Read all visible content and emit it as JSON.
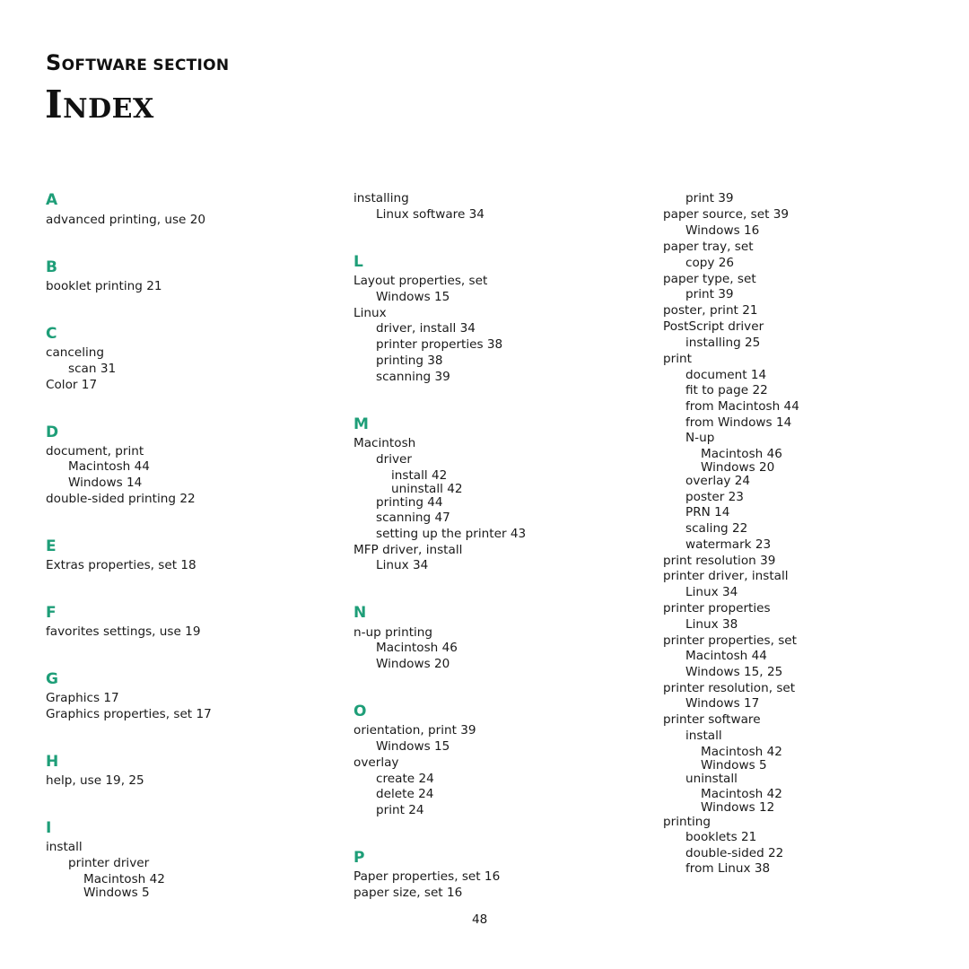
{
  "header": {
    "section_first": "S",
    "section_rest": "OFTWARE SECTION",
    "title_first": "I",
    "title_rest": "NDEX"
  },
  "accent_color": "#1e9e78",
  "page_number": "48",
  "columns": [
    {
      "items": [
        {
          "type": "letter",
          "text": "A"
        },
        {
          "type": "entry",
          "level": 0,
          "text": "advanced printing, use 20"
        },
        {
          "type": "letter",
          "text": "B"
        },
        {
          "type": "entry",
          "level": 0,
          "text": "booklet printing 21"
        },
        {
          "type": "letter",
          "text": "C"
        },
        {
          "type": "entry",
          "level": 0,
          "text": "canceling"
        },
        {
          "type": "entry",
          "level": 1,
          "text": "scan 31"
        },
        {
          "type": "entry",
          "level": 0,
          "text": "Color 17"
        },
        {
          "type": "letter",
          "text": "D"
        },
        {
          "type": "entry",
          "level": 0,
          "text": "document, print"
        },
        {
          "type": "entry",
          "level": 1,
          "text": "Macintosh 44"
        },
        {
          "type": "entry",
          "level": 1,
          "text": "Windows 14"
        },
        {
          "type": "entry",
          "level": 0,
          "text": "double-sided printing 22"
        },
        {
          "type": "letter",
          "text": "E"
        },
        {
          "type": "entry",
          "level": 0,
          "text": "Extras properties, set 18"
        },
        {
          "type": "letter",
          "text": "F"
        },
        {
          "type": "entry",
          "level": 0,
          "text": "favorites settings, use 19"
        },
        {
          "type": "letter",
          "text": "G"
        },
        {
          "type": "entry",
          "level": 0,
          "text": "Graphics 17"
        },
        {
          "type": "entry",
          "level": 0,
          "text": "Graphics properties, set 17"
        },
        {
          "type": "letter",
          "text": "H"
        },
        {
          "type": "entry",
          "level": 0,
          "text": "help, use 19, 25"
        },
        {
          "type": "letter",
          "text": "I"
        },
        {
          "type": "entry",
          "level": 0,
          "text": "install"
        },
        {
          "type": "entry",
          "level": 1,
          "text": "printer driver"
        },
        {
          "type": "entry",
          "level": 2,
          "text": "Macintosh 42"
        },
        {
          "type": "entry",
          "level": 2,
          "text": "Windows 5"
        }
      ]
    },
    {
      "items": [
        {
          "type": "entry",
          "level": 0,
          "text": "installing"
        },
        {
          "type": "entry",
          "level": 1,
          "text": "Linux software 34"
        },
        {
          "type": "letter",
          "text": "L"
        },
        {
          "type": "entry",
          "level": 0,
          "text": "Layout properties, set"
        },
        {
          "type": "entry",
          "level": 1,
          "text": "Windows 15"
        },
        {
          "type": "entry",
          "level": 0,
          "text": "Linux"
        },
        {
          "type": "entry",
          "level": 1,
          "text": "driver, install 34"
        },
        {
          "type": "entry",
          "level": 1,
          "text": "printer properties 38"
        },
        {
          "type": "entry",
          "level": 1,
          "text": "printing 38"
        },
        {
          "type": "entry",
          "level": 1,
          "text": "scanning 39"
        },
        {
          "type": "letter",
          "text": "M"
        },
        {
          "type": "entry",
          "level": 0,
          "text": "Macintosh"
        },
        {
          "type": "entry",
          "level": 1,
          "text": "driver"
        },
        {
          "type": "entry",
          "level": 2,
          "text": "install 42"
        },
        {
          "type": "entry",
          "level": 2,
          "text": "uninstall 42"
        },
        {
          "type": "entry",
          "level": 1,
          "text": "printing 44"
        },
        {
          "type": "entry",
          "level": 1,
          "text": "scanning 47"
        },
        {
          "type": "entry",
          "level": 1,
          "text": "setting up the printer 43"
        },
        {
          "type": "entry",
          "level": 0,
          "text": "MFP driver, install"
        },
        {
          "type": "entry",
          "level": 1,
          "text": "Linux 34"
        },
        {
          "type": "letter",
          "text": "N"
        },
        {
          "type": "entry",
          "level": 0,
          "text": "n-up printing"
        },
        {
          "type": "entry",
          "level": 1,
          "text": "Macintosh 46"
        },
        {
          "type": "entry",
          "level": 1,
          "text": "Windows 20"
        },
        {
          "type": "letter",
          "text": "O"
        },
        {
          "type": "entry",
          "level": 0,
          "text": "orientation, print 39"
        },
        {
          "type": "entry",
          "level": 1,
          "text": "Windows 15"
        },
        {
          "type": "entry",
          "level": 0,
          "text": "overlay"
        },
        {
          "type": "entry",
          "level": 1,
          "text": "create 24"
        },
        {
          "type": "entry",
          "level": 1,
          "text": "delete 24"
        },
        {
          "type": "entry",
          "level": 1,
          "text": "print 24"
        },
        {
          "type": "letter",
          "text": "P"
        },
        {
          "type": "entry",
          "level": 0,
          "text": "Paper properties, set 16"
        },
        {
          "type": "entry",
          "level": 0,
          "text": "paper size, set 16"
        }
      ]
    },
    {
      "items": [
        {
          "type": "entry",
          "level": 1,
          "text": "print 39"
        },
        {
          "type": "entry",
          "level": 0,
          "text": "paper source, set 39"
        },
        {
          "type": "entry",
          "level": 1,
          "text": "Windows 16"
        },
        {
          "type": "entry",
          "level": 0,
          "text": "paper tray, set"
        },
        {
          "type": "entry",
          "level": 1,
          "text": "copy 26"
        },
        {
          "type": "entry",
          "level": 0,
          "text": "paper type, set"
        },
        {
          "type": "entry",
          "level": 1,
          "text": "print 39"
        },
        {
          "type": "entry",
          "level": 0,
          "text": "poster, print 21"
        },
        {
          "type": "entry",
          "level": 0,
          "text": "PostScript driver"
        },
        {
          "type": "entry",
          "level": 1,
          "text": "installing 25"
        },
        {
          "type": "entry",
          "level": 0,
          "text": "print"
        },
        {
          "type": "entry",
          "level": 1,
          "text": "document 14"
        },
        {
          "type": "entry",
          "level": 1,
          "text": "fit to page 22"
        },
        {
          "type": "entry",
          "level": 1,
          "text": "from Macintosh 44"
        },
        {
          "type": "entry",
          "level": 1,
          "text": "from Windows 14"
        },
        {
          "type": "entry",
          "level": 1,
          "text": "N-up"
        },
        {
          "type": "entry",
          "level": 2,
          "text": "Macintosh 46"
        },
        {
          "type": "entry",
          "level": 2,
          "text": "Windows 20"
        },
        {
          "type": "entry",
          "level": 1,
          "text": "overlay 24"
        },
        {
          "type": "entry",
          "level": 1,
          "text": "poster 23"
        },
        {
          "type": "entry",
          "level": 1,
          "text": "PRN 14"
        },
        {
          "type": "entry",
          "level": 1,
          "text": "scaling 22"
        },
        {
          "type": "entry",
          "level": 1,
          "text": "watermark 23"
        },
        {
          "type": "entry",
          "level": 0,
          "text": "print resolution 39"
        },
        {
          "type": "entry",
          "level": 0,
          "text": "printer driver, install"
        },
        {
          "type": "entry",
          "level": 1,
          "text": "Linux 34"
        },
        {
          "type": "entry",
          "level": 0,
          "text": "printer properties"
        },
        {
          "type": "entry",
          "level": 1,
          "text": "Linux 38"
        },
        {
          "type": "entry",
          "level": 0,
          "text": "printer properties, set"
        },
        {
          "type": "entry",
          "level": 1,
          "text": "Macintosh 44"
        },
        {
          "type": "entry",
          "level": 1,
          "text": "Windows 15, 25"
        },
        {
          "type": "entry",
          "level": 0,
          "text": "printer resolution, set"
        },
        {
          "type": "entry",
          "level": 1,
          "text": "Windows 17"
        },
        {
          "type": "entry",
          "level": 0,
          "text": "printer software"
        },
        {
          "type": "entry",
          "level": 1,
          "text": "install"
        },
        {
          "type": "entry",
          "level": 2,
          "text": "Macintosh 42"
        },
        {
          "type": "entry",
          "level": 2,
          "text": "Windows 5"
        },
        {
          "type": "entry",
          "level": 1,
          "text": "uninstall"
        },
        {
          "type": "entry",
          "level": 2,
          "text": "Macintosh 42"
        },
        {
          "type": "entry",
          "level": 2,
          "text": "Windows 12"
        },
        {
          "type": "entry",
          "level": 0,
          "text": "printing"
        },
        {
          "type": "entry",
          "level": 1,
          "text": "booklets 21"
        },
        {
          "type": "entry",
          "level": 1,
          "text": "double-sided 22"
        },
        {
          "type": "entry",
          "level": 1,
          "text": "from Linux 38"
        }
      ]
    }
  ]
}
